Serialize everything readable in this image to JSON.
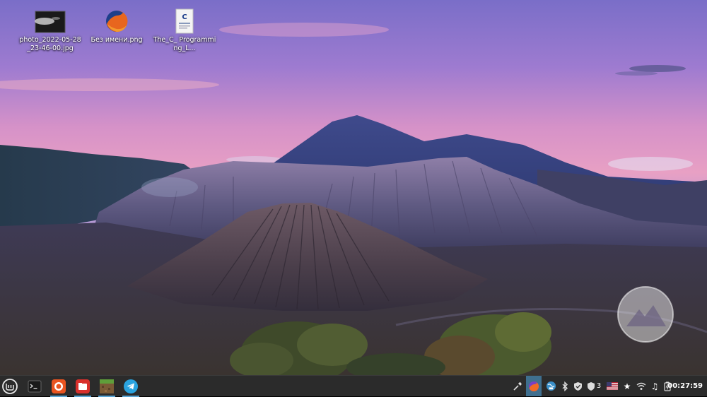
{
  "desktop": {
    "icons": [
      {
        "label": "photo_2022-05-28_23-46-00.jpg",
        "icon": "image-thumbnail-icon"
      },
      {
        "label": "Без имени.png",
        "icon": "firefox-image-icon"
      },
      {
        "label": "The_C_ Programming_L...",
        "icon": "pdf-document-icon"
      }
    ],
    "wallpaper": "Mount Bromo volcano at dusk",
    "watermark_icon": "mountain-logo-icon"
  },
  "taskbar": {
    "menu_icon": "linux-mint-menu-icon",
    "launchers": [
      {
        "name": "terminal",
        "icon": "terminal-icon",
        "running": false
      },
      {
        "name": "firefox",
        "icon": "firefox-icon",
        "running": true
      },
      {
        "name": "files",
        "icon": "folder-icon",
        "running": true
      },
      {
        "name": "minecraft",
        "icon": "minecraft-icon",
        "running": true
      },
      {
        "name": "telegram",
        "icon": "telegram-icon",
        "running": true
      }
    ],
    "tray": {
      "update_count": "3",
      "keyboard_layout": "us-flag-icon",
      "clock": "00:27:59"
    }
  },
  "colors": {
    "taskbar_bg": "#2b2b2b",
    "accent": "#5aa6d6"
  }
}
